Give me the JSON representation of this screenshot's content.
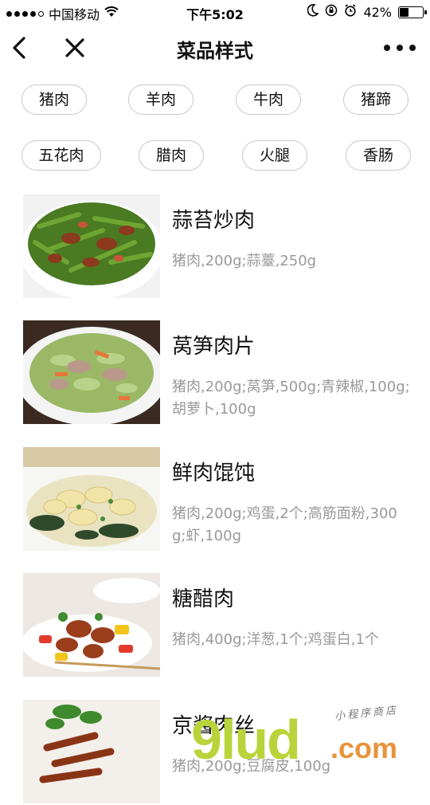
{
  "status_bar": {
    "carrier": "中国移动",
    "time": "下午5:02",
    "battery": "42%",
    "battery_level": 0.42,
    "signal_strength": 4,
    "signal_max": 5
  },
  "nav": {
    "title": "菜品样式",
    "back_icon": "chevron-left-icon",
    "close_icon": "close-icon",
    "more_icon": "more-horizontal-icon"
  },
  "categories": [
    [
      "猪肉",
      "羊肉",
      "牛肉",
      "猪蹄"
    ],
    [
      "五花肉",
      "腊肉",
      "火腿",
      "香肠"
    ]
  ],
  "dishes": [
    {
      "name": "蒜苔炒肉",
      "desc": "猪肉,200g;蒜薹,250g"
    },
    {
      "name": "莴笋肉片",
      "desc": "猪肉,200g;莴笋,500g;青辣椒,100g;胡萝卜,100g"
    },
    {
      "name": "鲜肉馄饨",
      "desc": "猪肉,200g;鸡蛋,2个;高筋面粉,300g;虾,100g"
    },
    {
      "name": "糖醋肉",
      "desc": "猪肉,400g;洋葱,1个;鸡蛋白,1个"
    },
    {
      "name": "京酱肉丝",
      "desc": "猪肉,200g;豆腐皮,100g"
    }
  ],
  "watermark": {
    "main": "9lud",
    "suffix": ".com",
    "tagline": "小程序商店"
  },
  "colors": {
    "chip_border": "#c8c8c8",
    "desc_text": "#999999",
    "watermark_green": "#b9d43a",
    "watermark_orange": "#e8923a"
  }
}
